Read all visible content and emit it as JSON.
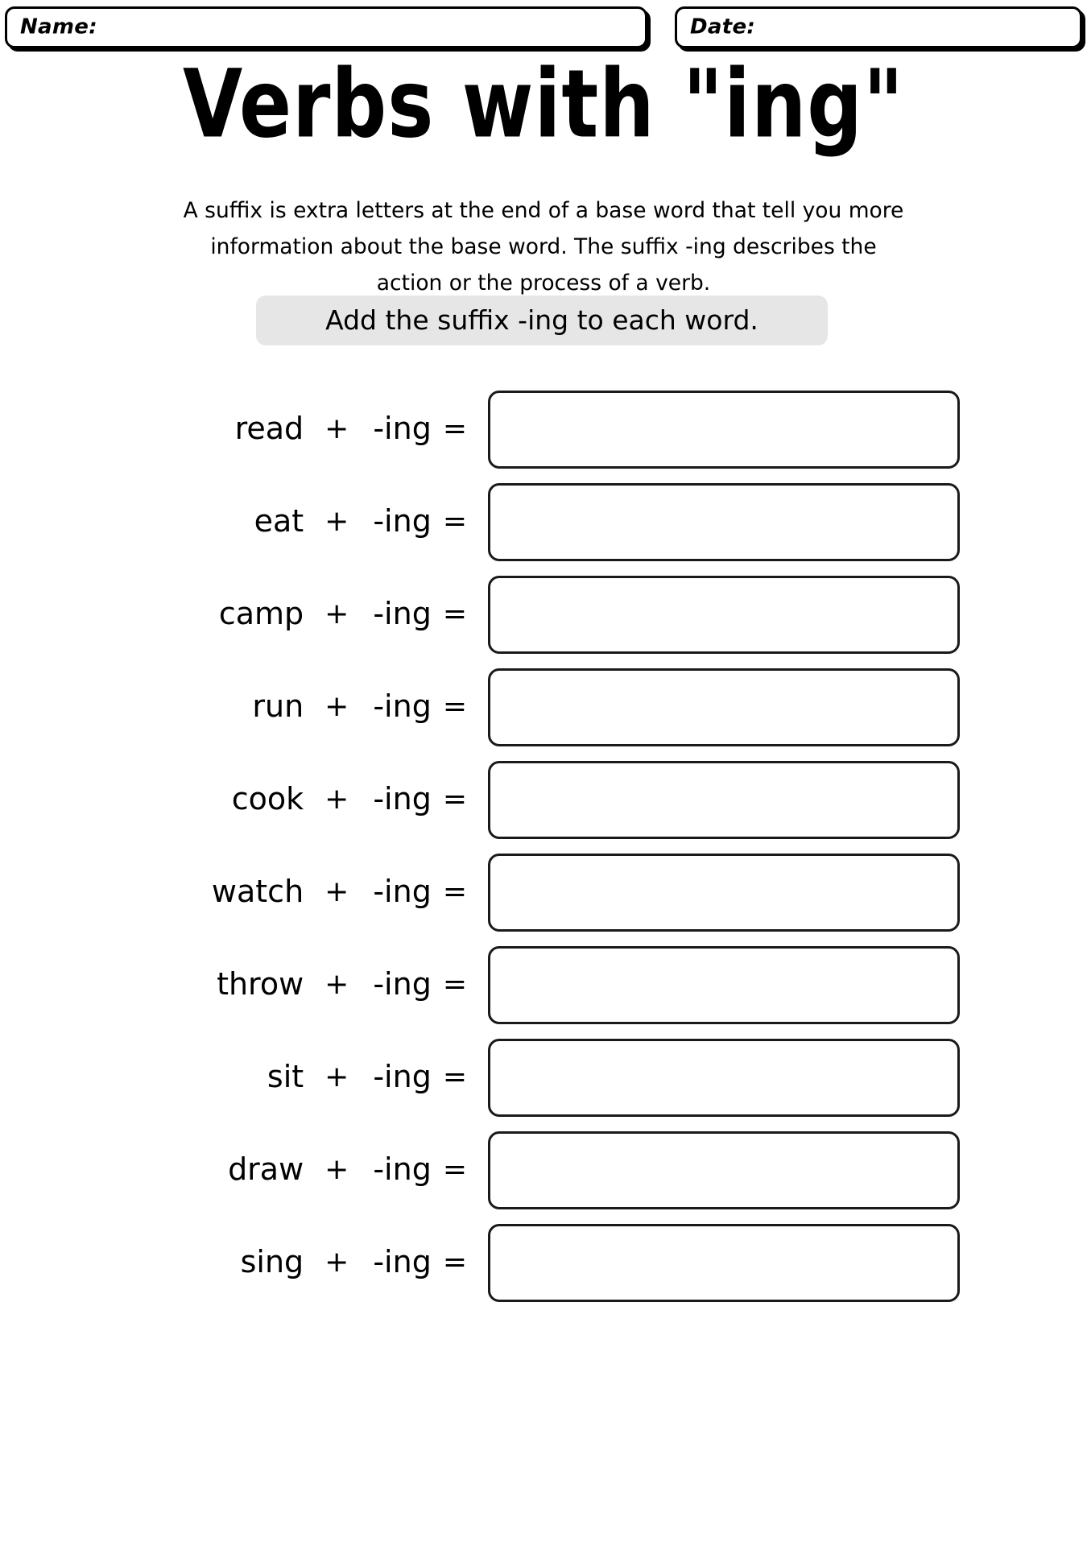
{
  "header": {
    "name_label": "Name:",
    "name_value": "",
    "date_label": "Date:",
    "date_value": ""
  },
  "title": "Verbs with \"ing\"",
  "intro": "A suffix is extra letters at the end of a base word that tell you more information about the base word. The suffix -ing describes the action or the process of a verb.",
  "directive": "Add the suffix -ing to each word.",
  "symbols": {
    "plus": "+",
    "equals": "=",
    "suffix": "-ing"
  },
  "exercises": [
    {
      "word": "read",
      "answer": ""
    },
    {
      "word": "eat",
      "answer": ""
    },
    {
      "word": "camp",
      "answer": ""
    },
    {
      "word": "run",
      "answer": ""
    },
    {
      "word": "cook",
      "answer": ""
    },
    {
      "word": "watch",
      "answer": ""
    },
    {
      "word": "throw",
      "answer": ""
    },
    {
      "word": "sit",
      "answer": ""
    },
    {
      "word": "draw",
      "answer": ""
    },
    {
      "word": "sing",
      "answer": ""
    }
  ],
  "colors": {
    "ink": "#000000",
    "directive_background": "#e6e6e6",
    "box_border": "#1a1a1a",
    "paper": "#ffffff"
  }
}
